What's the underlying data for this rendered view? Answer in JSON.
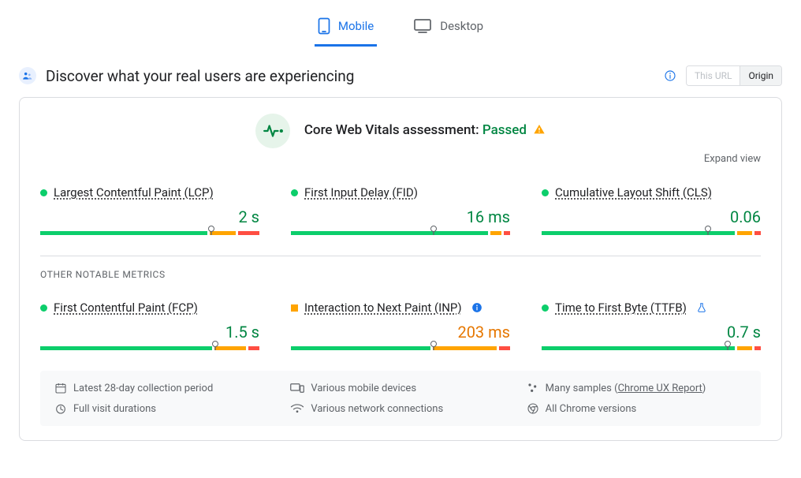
{
  "tabs": {
    "mobile": "Mobile",
    "desktop": "Desktop"
  },
  "heading": "Discover what your real users are experiencing",
  "scope": {
    "url": "This URL",
    "origin": "Origin"
  },
  "assessment": {
    "label": "Core Web Vitals assessment:",
    "status": "Passed"
  },
  "expand_view": "Expand view",
  "metrics": {
    "lcp": {
      "label": "Largest Contentful Paint (LCP)",
      "value": "2 s",
      "rating": "good",
      "dist": [
        78,
        12,
        10
      ],
      "marker": 78
    },
    "fid": {
      "label": "First Input Delay (FID)",
      "value": "16 ms",
      "rating": "good",
      "dist": [
        92,
        5,
        3
      ],
      "marker": 65
    },
    "cls": {
      "label": "Cumulative Layout Shift (CLS)",
      "value": "0.06",
      "rating": "good",
      "dist": [
        90,
        7,
        3
      ],
      "marker": 76
    },
    "fcp": {
      "label": "First Contentful Paint (FCP)",
      "value": "1.5 s",
      "rating": "good",
      "dist": [
        80,
        15,
        5
      ],
      "marker": 80
    },
    "inp": {
      "label": "Interaction to Next Paint (INP)",
      "value": "203 ms",
      "rating": "ni",
      "dist": [
        65,
        30,
        5
      ],
      "marker": 65
    },
    "ttfb": {
      "label": "Time to First Byte (TTFB)",
      "value": "0.7 s",
      "rating": "good",
      "dist": [
        90,
        7,
        3
      ],
      "marker": 85
    }
  },
  "other_heading": "OTHER NOTABLE METRICS",
  "footer": {
    "period": "Latest 28-day collection period",
    "devices": "Various mobile devices",
    "samples_pre": "Many samples (",
    "samples_link": "Chrome UX Report",
    "samples_post": ")",
    "durations": "Full visit durations",
    "networks": "Various network connections",
    "versions": "All Chrome versions"
  }
}
